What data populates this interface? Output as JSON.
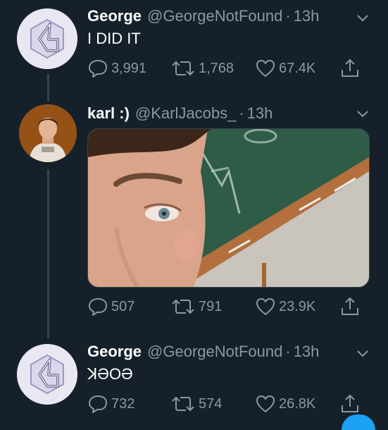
{
  "tweets": [
    {
      "name": "George",
      "handle": "@GeorgeNotFound",
      "time": "13h",
      "text": "I DID IT",
      "replies": "3,991",
      "retweets": "1,768",
      "likes": "67.4K"
    },
    {
      "name": "karl :)",
      "handle": "@KarlJacobs_",
      "time": "13h",
      "text": "",
      "replies": "507",
      "retweets": "791",
      "likes": "23.9K"
    },
    {
      "name": "George",
      "handle": "@GeorgeNotFound",
      "time": "13h",
      "text": "ꓘƏOƏ",
      "replies": "732",
      "retweets": "574",
      "likes": "26.8K"
    }
  ],
  "separator": "·",
  "colors": {
    "background": "#15202b",
    "secondary_text": "#8899a6",
    "thread_line": "#38444d",
    "accent": "#1da1f2"
  },
  "icons": [
    "chevron-down-icon",
    "reply-icon",
    "retweet-icon",
    "like-icon",
    "share-icon",
    "george-logo-icon"
  ]
}
